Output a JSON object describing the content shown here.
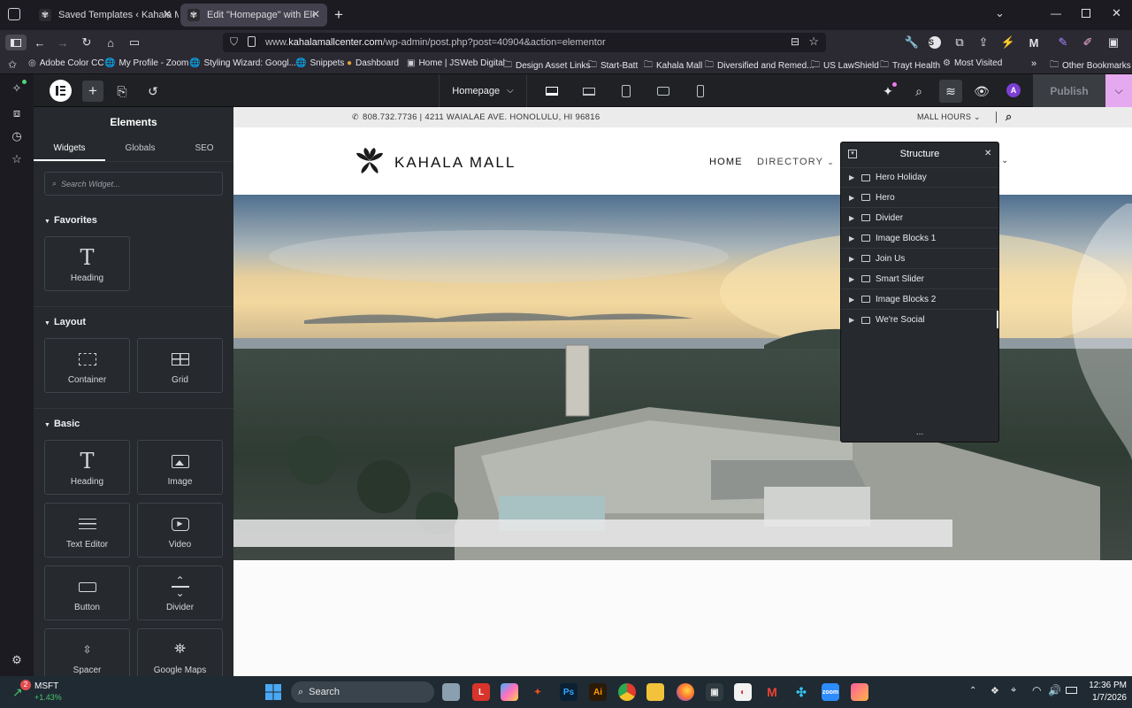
{
  "browser": {
    "tabs": [
      {
        "title": "Saved Templates ‹ Kahala Mall –",
        "active": false
      },
      {
        "title": "Edit \"Homepage\" with Elementor",
        "active": true
      }
    ],
    "url_prefix": "www.",
    "url_domain": "kahalamallcenter.com",
    "url_path": "/wp-admin/post.php?post=40904&action=elementor",
    "bookmarks": [
      "Adobe Color CC",
      "My Profile - Zoom",
      "Styling Wizard: Googl...",
      "Snippets",
      "Dashboard",
      "Home | JSWeb Digital",
      "Design Asset Links",
      "Start-Batt",
      "Kahala Mall",
      "Diversified and Remed...",
      "US LawShield",
      "Trayt Health",
      "Most Visited"
    ],
    "other_bookmarks": "Other Bookmarks"
  },
  "editor": {
    "page_name": "Homepage",
    "publish_label": "Publish",
    "avatar_initial": "A"
  },
  "panel": {
    "title": "Elements",
    "tabs": [
      "Widgets",
      "Globals",
      "SEO"
    ],
    "search_placeholder": "Search Widget...",
    "favorites_title": "Favorites",
    "favorites": [
      "Heading"
    ],
    "layout_title": "Layout",
    "layout": [
      "Container",
      "Grid"
    ],
    "basic_title": "Basic",
    "basic": [
      "Heading",
      "Image",
      "Text Editor",
      "Video",
      "Button",
      "Divider",
      "Spacer",
      "Google Maps"
    ]
  },
  "site": {
    "contact": "808.732.7736 | 4211 WAIALAE AVE. HONOLULU, HI 96816",
    "mall_hours": "MALL HOURS",
    "logo_text": "KAHALA MALL",
    "nav": [
      "HOME",
      "DIRECTORY"
    ]
  },
  "structure": {
    "title": "Structure",
    "items": [
      "Hero Holiday",
      "Hero",
      "Divider",
      "Image Blocks 1",
      "Join Us",
      "Smart Slider",
      "Image Blocks 2",
      "We're Social"
    ],
    "more": "..."
  },
  "taskbar": {
    "stock_name": "MSFT",
    "stock_change": "+1.43%",
    "stock_badge": "2",
    "search_label": "Search",
    "time": "12:36 PM",
    "date": "1/7/2026"
  },
  "colors": {
    "publish_bg": "#3a3d42",
    "dropdown_accent": "#e5a9f0",
    "avatar": "#7b3fd4",
    "panel_bg": "#26292d"
  }
}
